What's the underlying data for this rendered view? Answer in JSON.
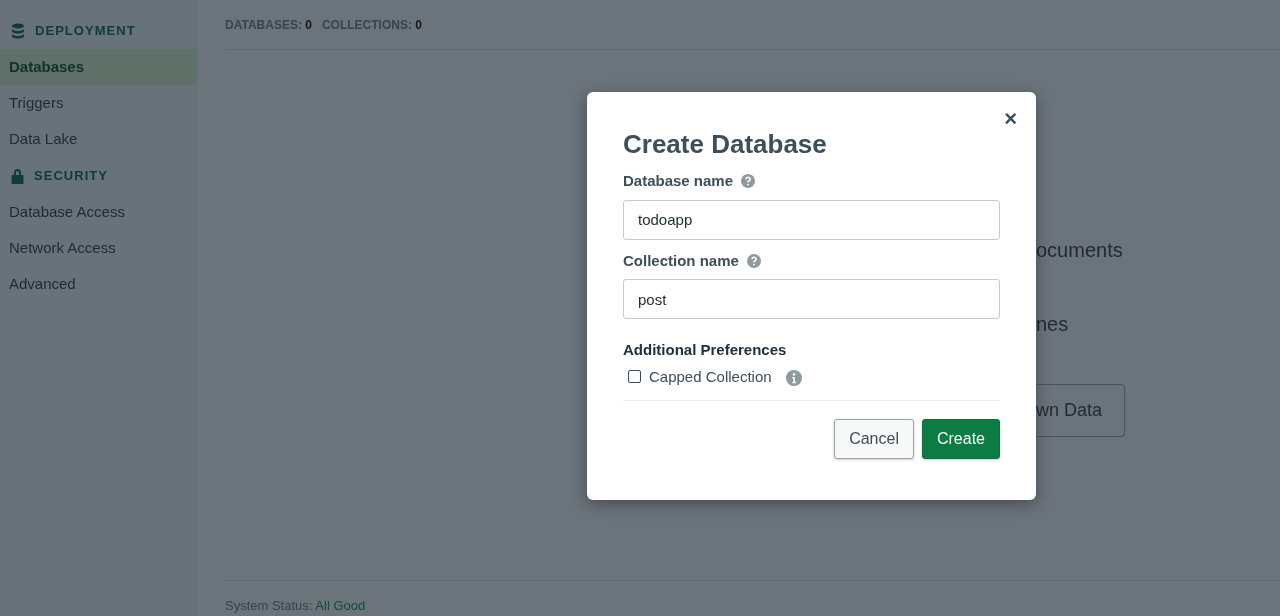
{
  "sidebar": {
    "sections": [
      {
        "kind": "deployment",
        "title": "DEPLOYMENT",
        "items": [
          {
            "label": "Databases",
            "selected": true
          },
          {
            "label": "Triggers",
            "selected": false
          },
          {
            "label": "Data Lake",
            "selected": false
          }
        ]
      },
      {
        "kind": "security",
        "title": "SECURITY",
        "items": [
          {
            "label": "Database Access",
            "selected": false
          },
          {
            "label": "Network Access",
            "selected": false
          },
          {
            "label": "Advanced",
            "selected": false
          }
        ]
      }
    ]
  },
  "stats": [
    {
      "label": "DATABASES:",
      "value": "0"
    },
    {
      "label": "COLLECTIONS:",
      "value": "0"
    }
  ],
  "background_texts": [
    "ocuments",
    "nes"
  ],
  "background_button": "wn Data",
  "status_bar": {
    "label": "System Status:",
    "value": "All Good"
  },
  "dialog": {
    "title": "Create Database",
    "close": "×",
    "fields": [
      {
        "label": "Database name",
        "value": "todoapp"
      },
      {
        "label": "Collection name",
        "value": "post"
      }
    ],
    "preferences_title": "Additional Preferences",
    "option": {
      "label": "Capped Collection",
      "checked": false
    },
    "buttons": [
      {
        "kind": "secondary",
        "label": "Cancel"
      },
      {
        "kind": "primary",
        "label": "Create"
      }
    ]
  }
}
